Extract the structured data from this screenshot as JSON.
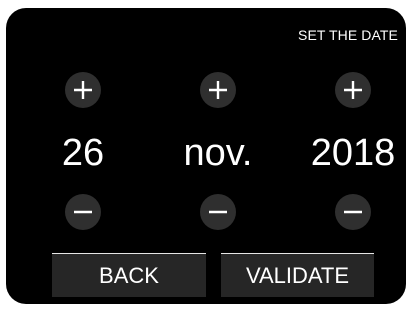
{
  "header": {
    "title": "SET THE DATE"
  },
  "date": {
    "day": "26",
    "month": "nov.",
    "year": "2018"
  },
  "controls": {
    "increment_icon": "plus-icon",
    "decrement_icon": "minus-icon"
  },
  "actions": {
    "back_label": "BACK",
    "validate_label": "VALIDATE"
  },
  "colors": {
    "background": "#000000",
    "button_fill": "#2f2f2f",
    "action_fill": "#262626",
    "text": "#ffffff"
  }
}
